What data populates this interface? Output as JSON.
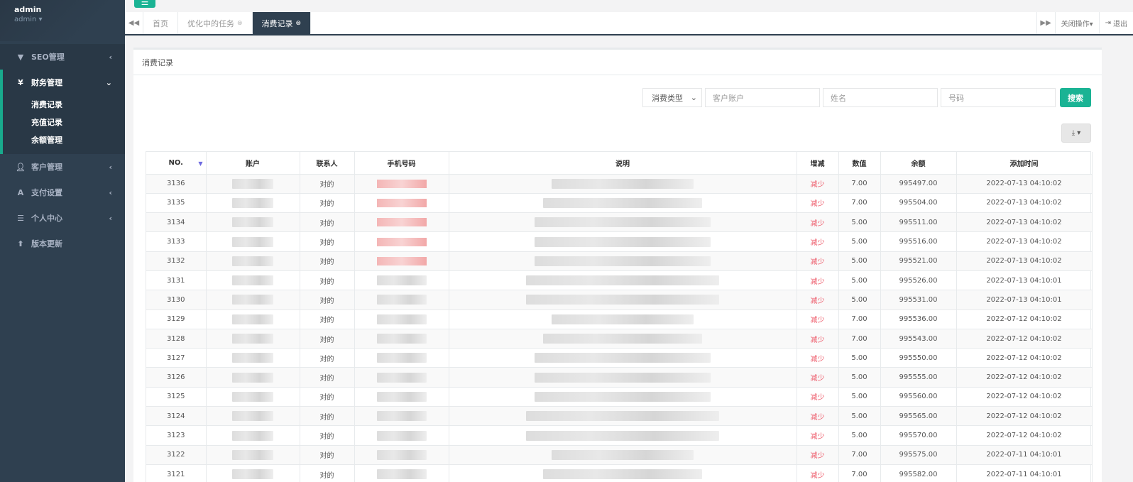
{
  "sidebar": {
    "user_name": "admin",
    "user_role": "admin ▾",
    "menu": [
      {
        "label": "SEO管理",
        "icon": "filter-icon",
        "glyph": "▼"
      },
      {
        "label": "财务管理",
        "icon": "yen-icon",
        "glyph": "¥"
      },
      {
        "label": "客户管理",
        "icon": "user-icon",
        "glyph": "●"
      },
      {
        "label": "支付设置",
        "icon": "font-icon",
        "glyph": "A"
      },
      {
        "label": "个人中心",
        "icon": "list-icon",
        "glyph": "☰"
      },
      {
        "label": "版本更新",
        "icon": "upload-icon",
        "glyph": "⬆"
      }
    ],
    "finance_sub": [
      "消费记录",
      "充值记录",
      "余额管理"
    ]
  },
  "tabs": {
    "items": [
      {
        "label": "首页"
      },
      {
        "label": "优化中的任务"
      },
      {
        "label": "消费记录"
      }
    ],
    "close_ops": "关闭操作▾",
    "logout": "退出"
  },
  "panel": {
    "title": "消费记录",
    "search": {
      "type_select": "消费类型",
      "account_placeholder": "客户账户",
      "name_placeholder": "姓名",
      "number_placeholder": "号码",
      "search_button": "搜索"
    }
  },
  "table": {
    "headers": [
      "NO.",
      "账户",
      "联系人",
      "手机号码",
      "说明",
      "增减",
      "数值",
      "余额",
      "添加时间"
    ],
    "rows": [
      {
        "no": "3136",
        "contact": "对的",
        "change": "减少",
        "amount": "7.00",
        "balance": "995497.00",
        "time": "2022-07-13 04:10:02"
      },
      {
        "no": "3135",
        "contact": "对的",
        "change": "减少",
        "amount": "7.00",
        "balance": "995504.00",
        "time": "2022-07-13 04:10:02"
      },
      {
        "no": "3134",
        "contact": "对的",
        "change": "减少",
        "amount": "5.00",
        "balance": "995511.00",
        "time": "2022-07-13 04:10:02"
      },
      {
        "no": "3133",
        "contact": "对的",
        "change": "减少",
        "amount": "5.00",
        "balance": "995516.00",
        "time": "2022-07-13 04:10:02"
      },
      {
        "no": "3132",
        "contact": "对的",
        "change": "减少",
        "amount": "5.00",
        "balance": "995521.00",
        "time": "2022-07-13 04:10:02"
      },
      {
        "no": "3131",
        "contact": "对的",
        "change": "减少",
        "amount": "5.00",
        "balance": "995526.00",
        "time": "2022-07-13 04:10:01"
      },
      {
        "no": "3130",
        "contact": "对的",
        "change": "减少",
        "amount": "5.00",
        "balance": "995531.00",
        "time": "2022-07-13 04:10:01"
      },
      {
        "no": "3129",
        "contact": "对的",
        "change": "减少",
        "amount": "7.00",
        "balance": "995536.00",
        "time": "2022-07-12 04:10:02"
      },
      {
        "no": "3128",
        "contact": "对的",
        "change": "减少",
        "amount": "7.00",
        "balance": "995543.00",
        "time": "2022-07-12 04:10:02"
      },
      {
        "no": "3127",
        "contact": "对的",
        "change": "减少",
        "amount": "5.00",
        "balance": "995550.00",
        "time": "2022-07-12 04:10:02"
      },
      {
        "no": "3126",
        "contact": "对的",
        "change": "减少",
        "amount": "5.00",
        "balance": "995555.00",
        "time": "2022-07-12 04:10:02"
      },
      {
        "no": "3125",
        "contact": "对的",
        "change": "减少",
        "amount": "5.00",
        "balance": "995560.00",
        "time": "2022-07-12 04:10:02"
      },
      {
        "no": "3124",
        "contact": "对的",
        "change": "减少",
        "amount": "5.00",
        "balance": "995565.00",
        "time": "2022-07-12 04:10:02"
      },
      {
        "no": "3123",
        "contact": "对的",
        "change": "减少",
        "amount": "5.00",
        "balance": "995570.00",
        "time": "2022-07-12 04:10:02"
      },
      {
        "no": "3122",
        "contact": "对的",
        "change": "减少",
        "amount": "7.00",
        "balance": "995575.00",
        "time": "2022-07-11 04:10:01"
      },
      {
        "no": "3121",
        "contact": "对的",
        "change": "减少",
        "amount": "7.00",
        "balance": "995582.00",
        "time": "2022-07-11 04:10:01"
      }
    ]
  }
}
